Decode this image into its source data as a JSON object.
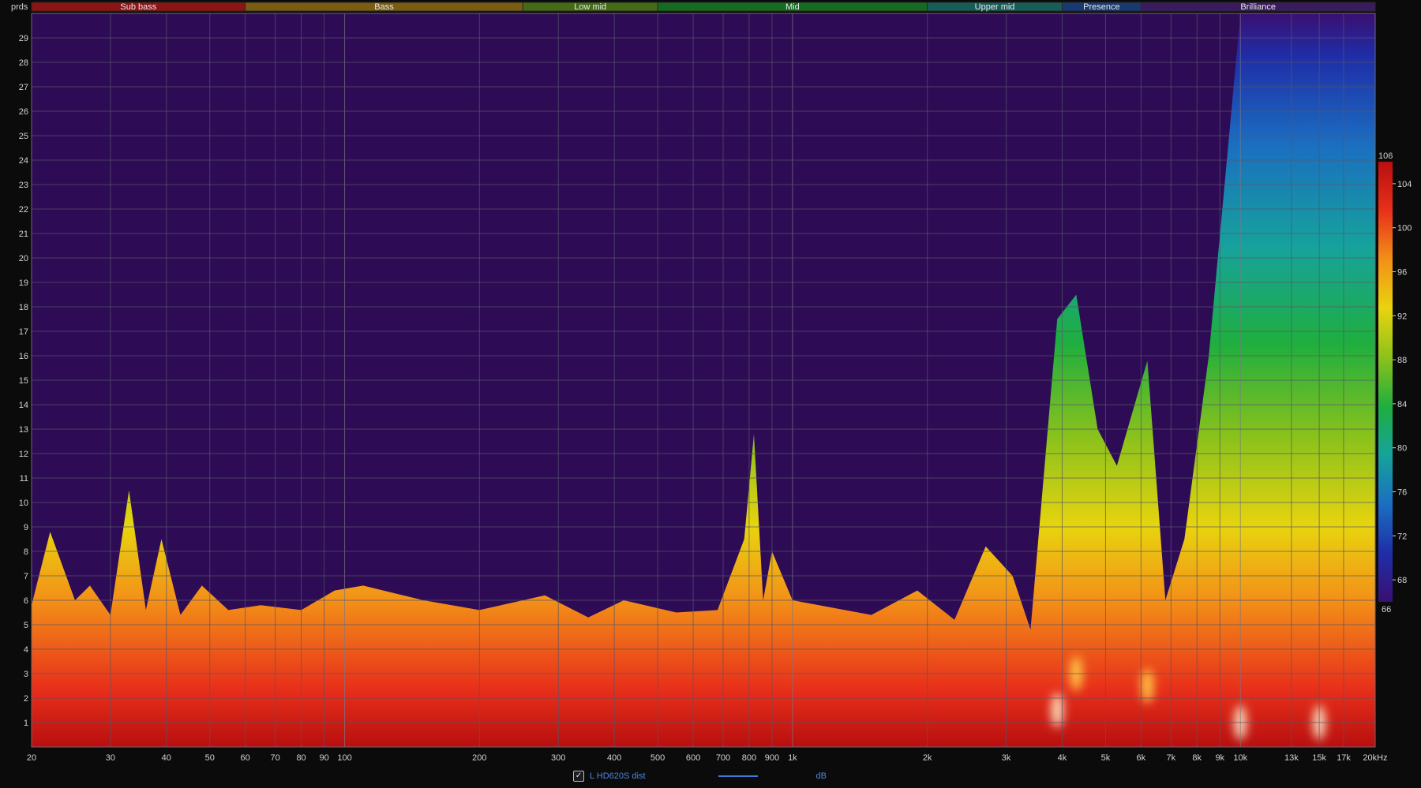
{
  "chart_data": {
    "type": "heatmap",
    "y_axis_label": "prds",
    "x_axis": {
      "scale": "log",
      "range_hz": [
        20,
        20000
      ],
      "ticks": [
        {
          "v": 20,
          "label": "20"
        },
        {
          "v": 30,
          "label": "30"
        },
        {
          "v": 40,
          "label": "40"
        },
        {
          "v": 50,
          "label": "50"
        },
        {
          "v": 60,
          "label": "60"
        },
        {
          "v": 70,
          "label": "70"
        },
        {
          "v": 80,
          "label": "80"
        },
        {
          "v": 90,
          "label": "90"
        },
        {
          "v": 100,
          "label": "100"
        },
        {
          "v": 200,
          "label": "200"
        },
        {
          "v": 300,
          "label": "300"
        },
        {
          "v": 400,
          "label": "400"
        },
        {
          "v": 500,
          "label": "500"
        },
        {
          "v": 600,
          "label": "600"
        },
        {
          "v": 700,
          "label": "700"
        },
        {
          "v": 800,
          "label": "800"
        },
        {
          "v": 900,
          "label": "900"
        },
        {
          "v": 1000,
          "label": "1k"
        },
        {
          "v": 2000,
          "label": "2k"
        },
        {
          "v": 3000,
          "label": "3k"
        },
        {
          "v": 4000,
          "label": "4k"
        },
        {
          "v": 5000,
          "label": "5k"
        },
        {
          "v": 6000,
          "label": "6k"
        },
        {
          "v": 7000,
          "label": "7k"
        },
        {
          "v": 8000,
          "label": "8k"
        },
        {
          "v": 9000,
          "label": "9k"
        },
        {
          "v": 10000,
          "label": "10k"
        },
        {
          "v": 13000,
          "label": "13k"
        },
        {
          "v": 15000,
          "label": "15k"
        },
        {
          "v": 17000,
          "label": "17k"
        },
        {
          "v": 20000,
          "label": "20kHz"
        }
      ]
    },
    "y_axis": {
      "range": [
        0,
        30
      ],
      "ticks": [
        1,
        2,
        3,
        4,
        5,
        6,
        7,
        8,
        9,
        10,
        11,
        12,
        13,
        14,
        15,
        16,
        17,
        18,
        19,
        20,
        21,
        22,
        23,
        24,
        25,
        26,
        27,
        28,
        29
      ]
    },
    "bands": [
      {
        "name": "Sub bass",
        "from": 20,
        "to": 60,
        "color": "#8e1313"
      },
      {
        "name": "Bass",
        "from": 60,
        "to": 250,
        "color": "#7b5d12"
      },
      {
        "name": "Low mid",
        "from": 250,
        "to": 500,
        "color": "#456b17"
      },
      {
        "name": "Mid",
        "from": 500,
        "to": 2000,
        "color": "#156b20"
      },
      {
        "name": "Upper mid",
        "from": 2000,
        "to": 4000,
        "color": "#155e58"
      },
      {
        "name": "Presence",
        "from": 4000,
        "to": 6000,
        "color": "#183a72"
      },
      {
        "name": "Brilliance",
        "from": 6000,
        "to": 20000,
        "color": "#3a1b5e"
      }
    ],
    "color_scale": {
      "min_db": 66,
      "max_db": 106,
      "ticks": [
        68,
        72,
        76,
        80,
        84,
        88,
        92,
        96,
        100,
        104
      ],
      "top_label": "106",
      "bottom_label": "66",
      "stops": [
        "#3a0f72",
        "#1f2ea8",
        "#1b6fc0",
        "#16a39b",
        "#1fae3e",
        "#8cc21b",
        "#e8d40e",
        "#f39018",
        "#e8301a",
        "#b80f0f"
      ]
    },
    "decay_profile_cycles": [
      {
        "hz": 20,
        "c": 5.8
      },
      {
        "hz": 22,
        "c": 8.8
      },
      {
        "hz": 25,
        "c": 6.0
      },
      {
        "hz": 27,
        "c": 6.6
      },
      {
        "hz": 30,
        "c": 5.4
      },
      {
        "hz": 33,
        "c": 10.5
      },
      {
        "hz": 36,
        "c": 5.6
      },
      {
        "hz": 39,
        "c": 8.5
      },
      {
        "hz": 43,
        "c": 5.4
      },
      {
        "hz": 48,
        "c": 6.6
      },
      {
        "hz": 55,
        "c": 5.6
      },
      {
        "hz": 65,
        "c": 5.8
      },
      {
        "hz": 80,
        "c": 5.6
      },
      {
        "hz": 95,
        "c": 6.4
      },
      {
        "hz": 110,
        "c": 6.6
      },
      {
        "hz": 150,
        "c": 6.0
      },
      {
        "hz": 200,
        "c": 5.6
      },
      {
        "hz": 280,
        "c": 6.2
      },
      {
        "hz": 350,
        "c": 5.3
      },
      {
        "hz": 420,
        "c": 6.0
      },
      {
        "hz": 550,
        "c": 5.5
      },
      {
        "hz": 680,
        "c": 5.6
      },
      {
        "hz": 780,
        "c": 8.5
      },
      {
        "hz": 820,
        "c": 12.8
      },
      {
        "hz": 860,
        "c": 6.0
      },
      {
        "hz": 900,
        "c": 8.0
      },
      {
        "hz": 1000,
        "c": 6.0
      },
      {
        "hz": 1500,
        "c": 5.4
      },
      {
        "hz": 1900,
        "c": 6.4
      },
      {
        "hz": 2300,
        "c": 5.2
      },
      {
        "hz": 2700,
        "c": 8.2
      },
      {
        "hz": 3100,
        "c": 7.0
      },
      {
        "hz": 3400,
        "c": 4.8
      },
      {
        "hz": 3900,
        "c": 17.5
      },
      {
        "hz": 4300,
        "c": 18.5
      },
      {
        "hz": 4800,
        "c": 13.0
      },
      {
        "hz": 5300,
        "c": 11.5
      },
      {
        "hz": 6200,
        "c": 15.8
      },
      {
        "hz": 6800,
        "c": 6.0
      },
      {
        "hz": 7500,
        "c": 8.5
      },
      {
        "hz": 8500,
        "c": 16.0
      },
      {
        "hz": 10000,
        "c": 30
      },
      {
        "hz": 20000,
        "c": 30
      }
    ],
    "legend": {
      "label": "L HD620S dist",
      "checked": true,
      "unit": "dB"
    }
  }
}
